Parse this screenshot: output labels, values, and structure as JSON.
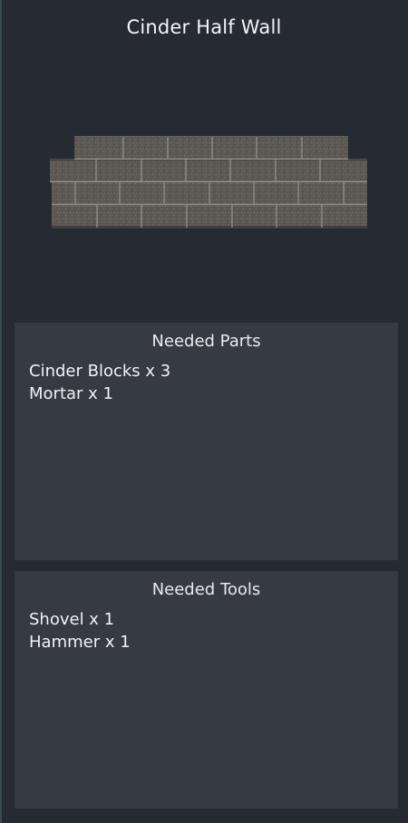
{
  "item": {
    "title": "Cinder Half Wall",
    "preview_icon": "cinder-block-wall-icon",
    "preview_colors": {
      "block": "#5e5b55",
      "mortar": "#8d8a83",
      "shadow": "#3e3c38"
    }
  },
  "needed_parts": {
    "header": "Needed Parts",
    "items": [
      {
        "label": "Cinder Blocks x 3"
      },
      {
        "label": "Mortar x 1"
      }
    ]
  },
  "needed_tools": {
    "header": "Needed Tools",
    "items": [
      {
        "label": "Shovel x 1"
      },
      {
        "label": "Hammer x 1"
      }
    ]
  }
}
